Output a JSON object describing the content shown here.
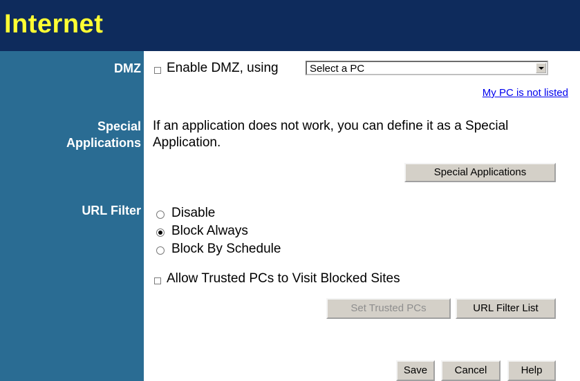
{
  "header": {
    "title": "Internet"
  },
  "dmz": {
    "label": "DMZ",
    "enable_label": "Enable DMZ, using",
    "enabled": false,
    "select_value": "Select a PC",
    "pc_not_listed_link": "My PC is not listed"
  },
  "special": {
    "label_line1": "Special",
    "label_line2": "Applications",
    "description_line1": "If an application does not work, you can define it as a Special",
    "description_line2": "Application.",
    "button": "Special Applications"
  },
  "url_filter": {
    "label": "URL Filter",
    "options": [
      {
        "label": "Disable",
        "selected": false
      },
      {
        "label": "Block Always",
        "selected": true
      },
      {
        "label": "Block By Schedule",
        "selected": false
      }
    ],
    "allow_trusted_label": "Allow Trusted PCs to Visit Blocked Sites",
    "allow_trusted_checked": false,
    "set_trusted_button": "Set Trusted PCs",
    "filter_list_button": "URL Filter List"
  },
  "footer": {
    "save": "Save",
    "cancel": "Cancel",
    "help": "Help"
  }
}
